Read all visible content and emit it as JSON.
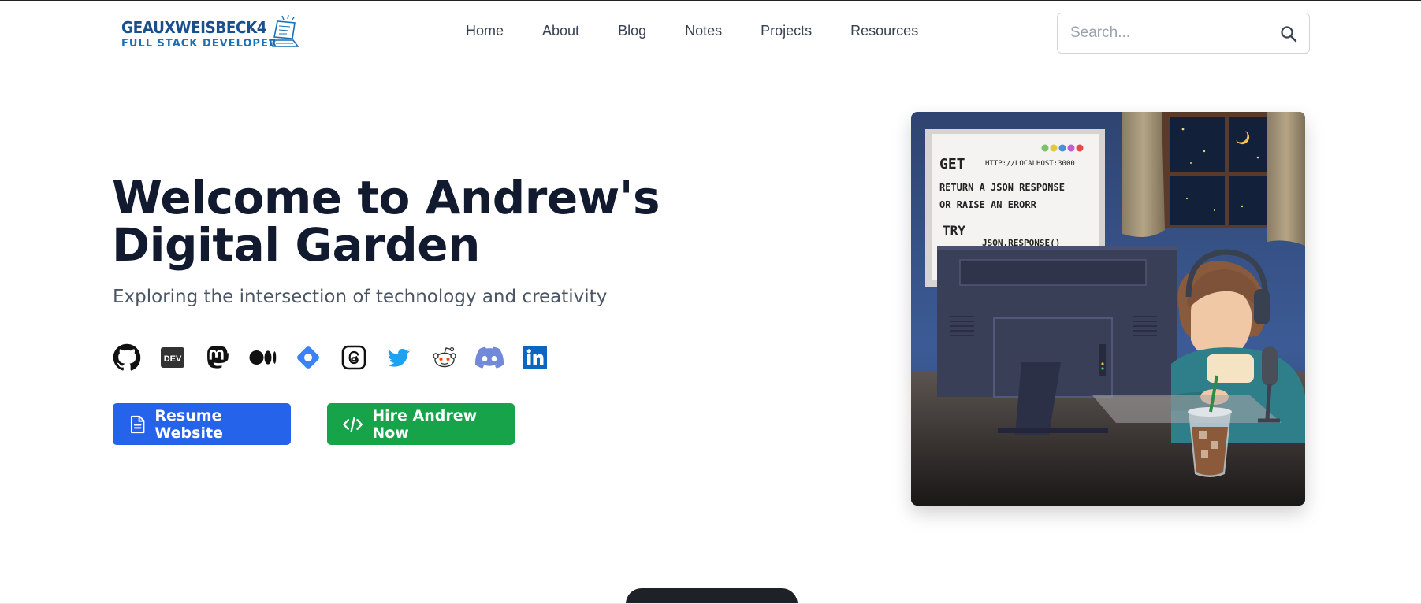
{
  "brand": {
    "name": "GEAUXWEISBECK4",
    "tagline": "FULL STACK DEVELOPER"
  },
  "nav": {
    "items": [
      "Home",
      "About",
      "Blog",
      "Notes",
      "Projects",
      "Resources"
    ]
  },
  "search": {
    "placeholder": "Search..."
  },
  "hero": {
    "title": "Welcome to Andrew's Digital Garden",
    "subtitle": "Exploring the intersection of technology and creativity"
  },
  "socials": [
    {
      "name": "github-icon",
      "color": "#111111"
    },
    {
      "name": "dev-icon",
      "color": "#333333"
    },
    {
      "name": "mastodon-icon",
      "color": "#111111"
    },
    {
      "name": "medium-icon",
      "color": "#111111"
    },
    {
      "name": "bluesky-icon",
      "color": "#3b82f6"
    },
    {
      "name": "threads-icon",
      "color": "#111111"
    },
    {
      "name": "twitter-icon",
      "color": "#1da1f2"
    },
    {
      "name": "reddit-icon",
      "color": "#ff4500"
    },
    {
      "name": "discord-icon",
      "color": "#7289da"
    },
    {
      "name": "linkedin-icon",
      "color": "#0a66c2"
    }
  ],
  "buttons": {
    "resume": "Resume Website",
    "hire": "Hire Andrew Now"
  },
  "illustration": {
    "board_get": "GET",
    "board_url": "HTTP://LOCALHOST:3000",
    "board_line1": "RETURN A JSON RESPONSE",
    "board_line2": "OR RAISE AN ERORR",
    "board_try": "TRY",
    "board_code": "JSON.RESPONSE()"
  },
  "colors": {
    "primary_blue": "#2563eb",
    "primary_green": "#16a34a",
    "title": "#111a2e",
    "brand": "#1b4f8c"
  }
}
